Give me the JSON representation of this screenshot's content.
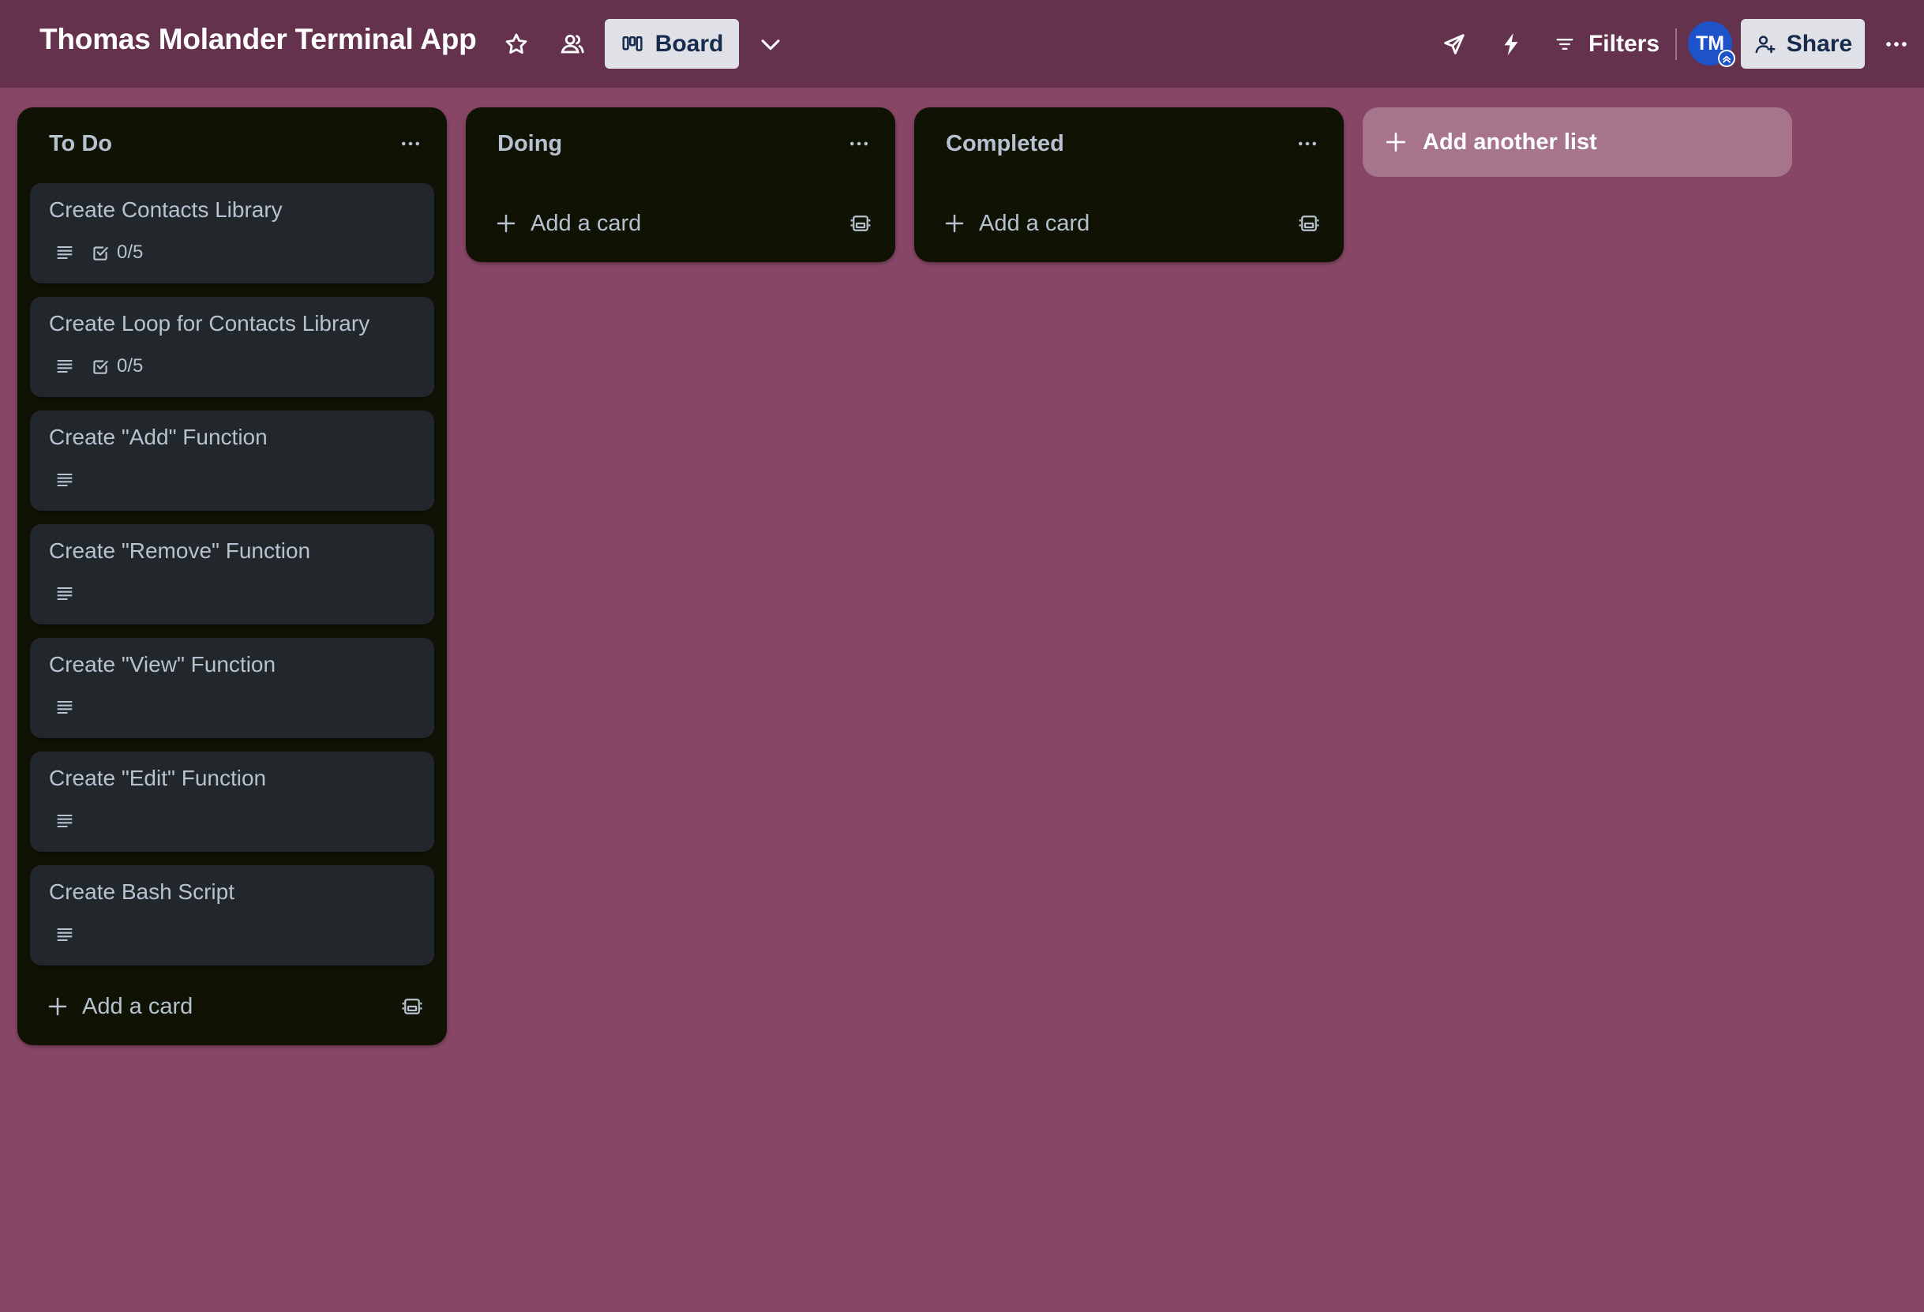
{
  "header": {
    "board_title": "Thomas Molander Terminal App",
    "view_label": "Board",
    "filters_label": "Filters",
    "avatar_initials": "TM",
    "share_label": "Share",
    "icons": [
      "star-icon",
      "team-visibility-icon",
      "board-view-icon",
      "chevron-down-icon",
      "power-ups-icon",
      "automation-bolt-icon",
      "filter-icon",
      "add-member-icon",
      "more-icon"
    ]
  },
  "colors": {
    "background": "#874665",
    "header": "#65324e",
    "list": "#101204",
    "card": "#22272b",
    "text": "#b6c2cf",
    "avatar": "#1d52c9"
  },
  "lists": [
    {
      "title": "To Do",
      "cards": [
        {
          "title": "Create Contacts Library",
          "has_description": true,
          "checklist": "0/5"
        },
        {
          "title": "Create Loop for Contacts Library",
          "has_description": true,
          "checklist": "0/5"
        },
        {
          "title": "Create \"Add\" Function",
          "has_description": true
        },
        {
          "title": "Create \"Remove\" Function",
          "has_description": true
        },
        {
          "title": "Create \"View\" Function",
          "has_description": true
        },
        {
          "title": "Create \"Edit\" Function",
          "has_description": true
        },
        {
          "title": "Create Bash Script",
          "has_description": true
        }
      ],
      "add_card_label": "Add a card"
    },
    {
      "title": "Doing",
      "cards": [],
      "add_card_label": "Add a card"
    },
    {
      "title": "Completed",
      "cards": [],
      "add_card_label": "Add a card"
    }
  ],
  "add_list_label": "Add another list"
}
